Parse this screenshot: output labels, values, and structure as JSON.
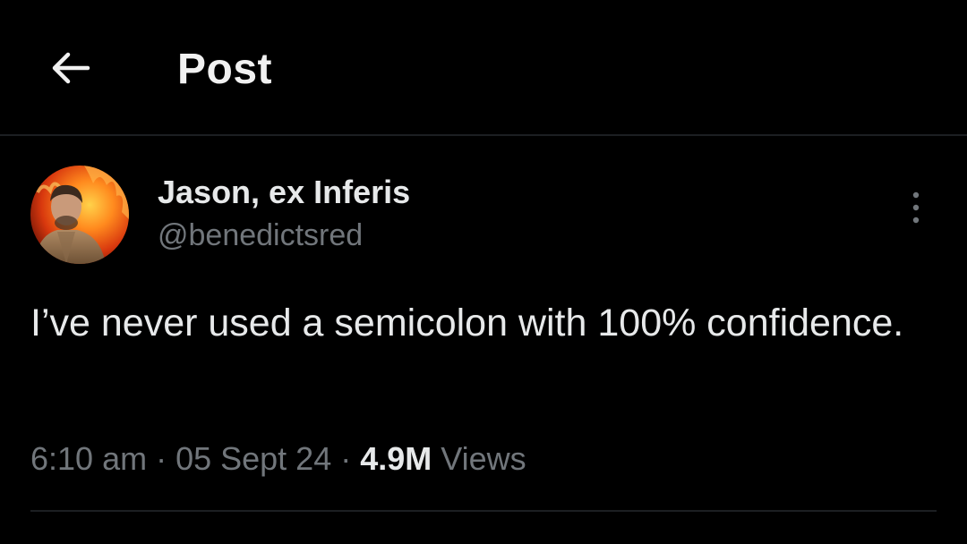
{
  "header": {
    "back_icon": "arrow-left-icon",
    "title": "Post"
  },
  "post": {
    "author": {
      "display_name": "Jason, ex Inferis",
      "handle": "@benedictsred",
      "avatar_icon": "avatar-photo-icon"
    },
    "more_icon": "more-vertical-icon",
    "text": "I’ve never used a semicolon with 100% confidence.",
    "meta": {
      "time": "6:10 am",
      "separator": " · ",
      "date": "05 Sept 24",
      "views_count": "4.9M",
      "views_label": "Views"
    }
  },
  "colors": {
    "background": "#000000",
    "primary_text": "#e7e9ea",
    "secondary_text": "#71767b",
    "divider": "#1c1f22"
  }
}
